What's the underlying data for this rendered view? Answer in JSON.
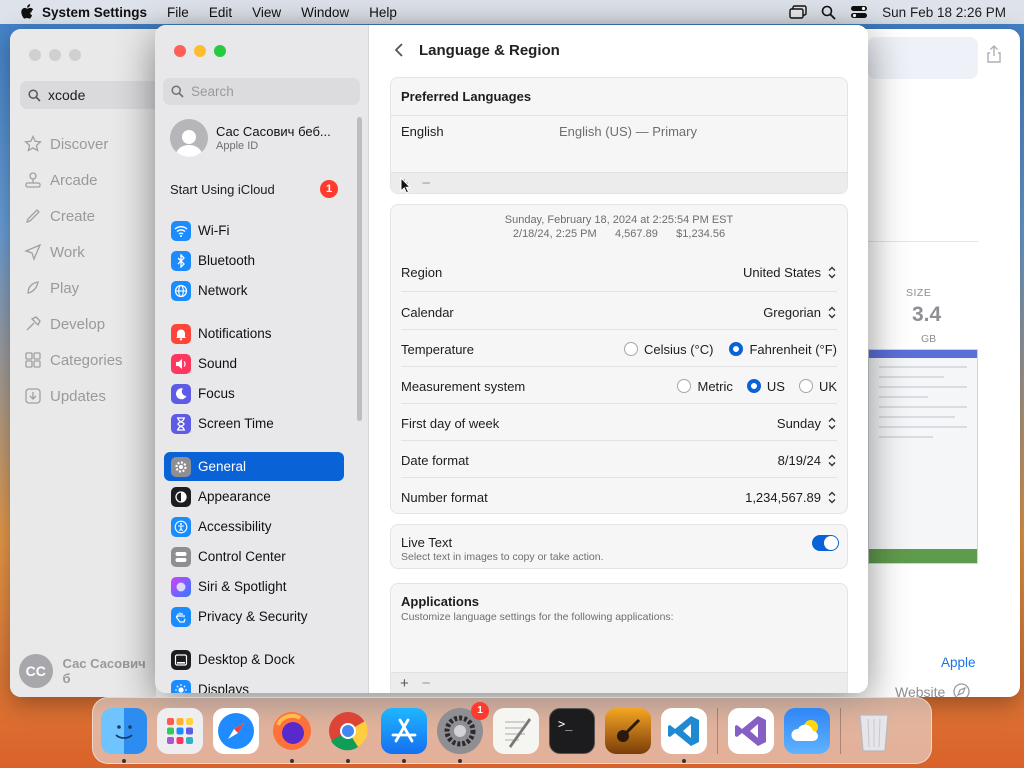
{
  "menubar": {
    "app": "System Settings",
    "items": [
      "File",
      "Edit",
      "View",
      "Window",
      "Help"
    ],
    "clock": "Sun Feb 18  2:26 PM"
  },
  "appstore": {
    "search_value": "xcode",
    "nav": [
      "Discover",
      "Arcade",
      "Create",
      "Work",
      "Play",
      "Develop",
      "Categories",
      "Updates"
    ],
    "user_initials": "CC",
    "user_name": "Сас Сасович б",
    "size_label": "SIZE",
    "size_value": "3.4",
    "size_unit": "GB",
    "developer_link": "Apple",
    "website_link": "Website"
  },
  "settings": {
    "search_placeholder": "Search",
    "profile": {
      "name": "Сас Сасович беб...",
      "sub": "Apple ID"
    },
    "icloud": {
      "label": "Start Using iCloud",
      "badge": "1"
    },
    "sidebar": [
      {
        "label": "Wi-Fi",
        "icon": "wifi-icon",
        "color": "#1a8cff"
      },
      {
        "label": "Bluetooth",
        "icon": "bluetooth-icon",
        "color": "#1a8cff"
      },
      {
        "label": "Network",
        "icon": "globe-icon",
        "color": "#1a8cff"
      },
      {
        "label": "Notifications",
        "icon": "bell-icon",
        "color": "#ff453a"
      },
      {
        "label": "Sound",
        "icon": "speaker-icon",
        "color": "#ff375f"
      },
      {
        "label": "Focus",
        "icon": "moon-icon",
        "color": "#5e5ce6"
      },
      {
        "label": "Screen Time",
        "icon": "hourglass-icon",
        "color": "#5e5ce6"
      },
      {
        "label": "General",
        "icon": "gear-icon",
        "color": "#8e8e93"
      },
      {
        "label": "Appearance",
        "icon": "appearance-icon",
        "color": "#1d1d1f"
      },
      {
        "label": "Accessibility",
        "icon": "accessibility-icon",
        "color": "#1a8cff"
      },
      {
        "label": "Control Center",
        "icon": "control-center-icon",
        "color": "#8e8e93"
      },
      {
        "label": "Siri & Spotlight",
        "icon": "siri-icon",
        "color": "#7d3cff"
      },
      {
        "label": "Privacy & Security",
        "icon": "hand-icon",
        "color": "#1a8cff"
      },
      {
        "label": "Desktop & Dock",
        "icon": "dock-icon",
        "color": "#1d1d1f"
      },
      {
        "label": "Displays",
        "icon": "sun-icon",
        "color": "#1a8cff"
      }
    ],
    "page_title": "Language & Region",
    "preferred": {
      "title": "Preferred Languages",
      "language": "English",
      "detail": "English (US) — Primary",
      "plus": "+",
      "minus": "−"
    },
    "sample": {
      "line1": "Sunday, February 18, 2024 at 2:25:54 PM EST",
      "line2": "2/18/24, 2:25 PM      4,567.89      $1,234.56"
    },
    "region": {
      "label": "Region",
      "value": "United States"
    },
    "calendar": {
      "label": "Calendar",
      "value": "Gregorian"
    },
    "temperature": {
      "label": "Temperature",
      "options": [
        "Celsius (°C)",
        "Fahrenheit (°F)"
      ],
      "selected": "Fahrenheit (°F)"
    },
    "measurement": {
      "label": "Measurement system",
      "options": [
        "Metric",
        "US",
        "UK"
      ],
      "selected": "US"
    },
    "first_day": {
      "label": "First day of week",
      "value": "Sunday"
    },
    "date_format": {
      "label": "Date format",
      "value": "8/19/24"
    },
    "number_format": {
      "label": "Number format",
      "value": "1,234,567.89"
    },
    "live_text": {
      "title": "Live Text",
      "desc": "Select text in images to copy or take action.",
      "enabled": true
    },
    "applications": {
      "title": "Applications",
      "desc": "Customize language settings for the following applications:",
      "plus": "+",
      "minus": "−"
    }
  },
  "dock": {
    "settings_badge": "1",
    "apps": [
      "Finder",
      "Launchpad",
      "Safari",
      "Firefox",
      "Chrome",
      "App Store",
      "System Settings",
      "TextEdit",
      "Terminal",
      "Instruments",
      "VS Code",
      "Visual Studio",
      "Weather",
      "Trash"
    ]
  },
  "colors": {
    "accent": "#0a63d6",
    "badge": "#ff3b30"
  }
}
